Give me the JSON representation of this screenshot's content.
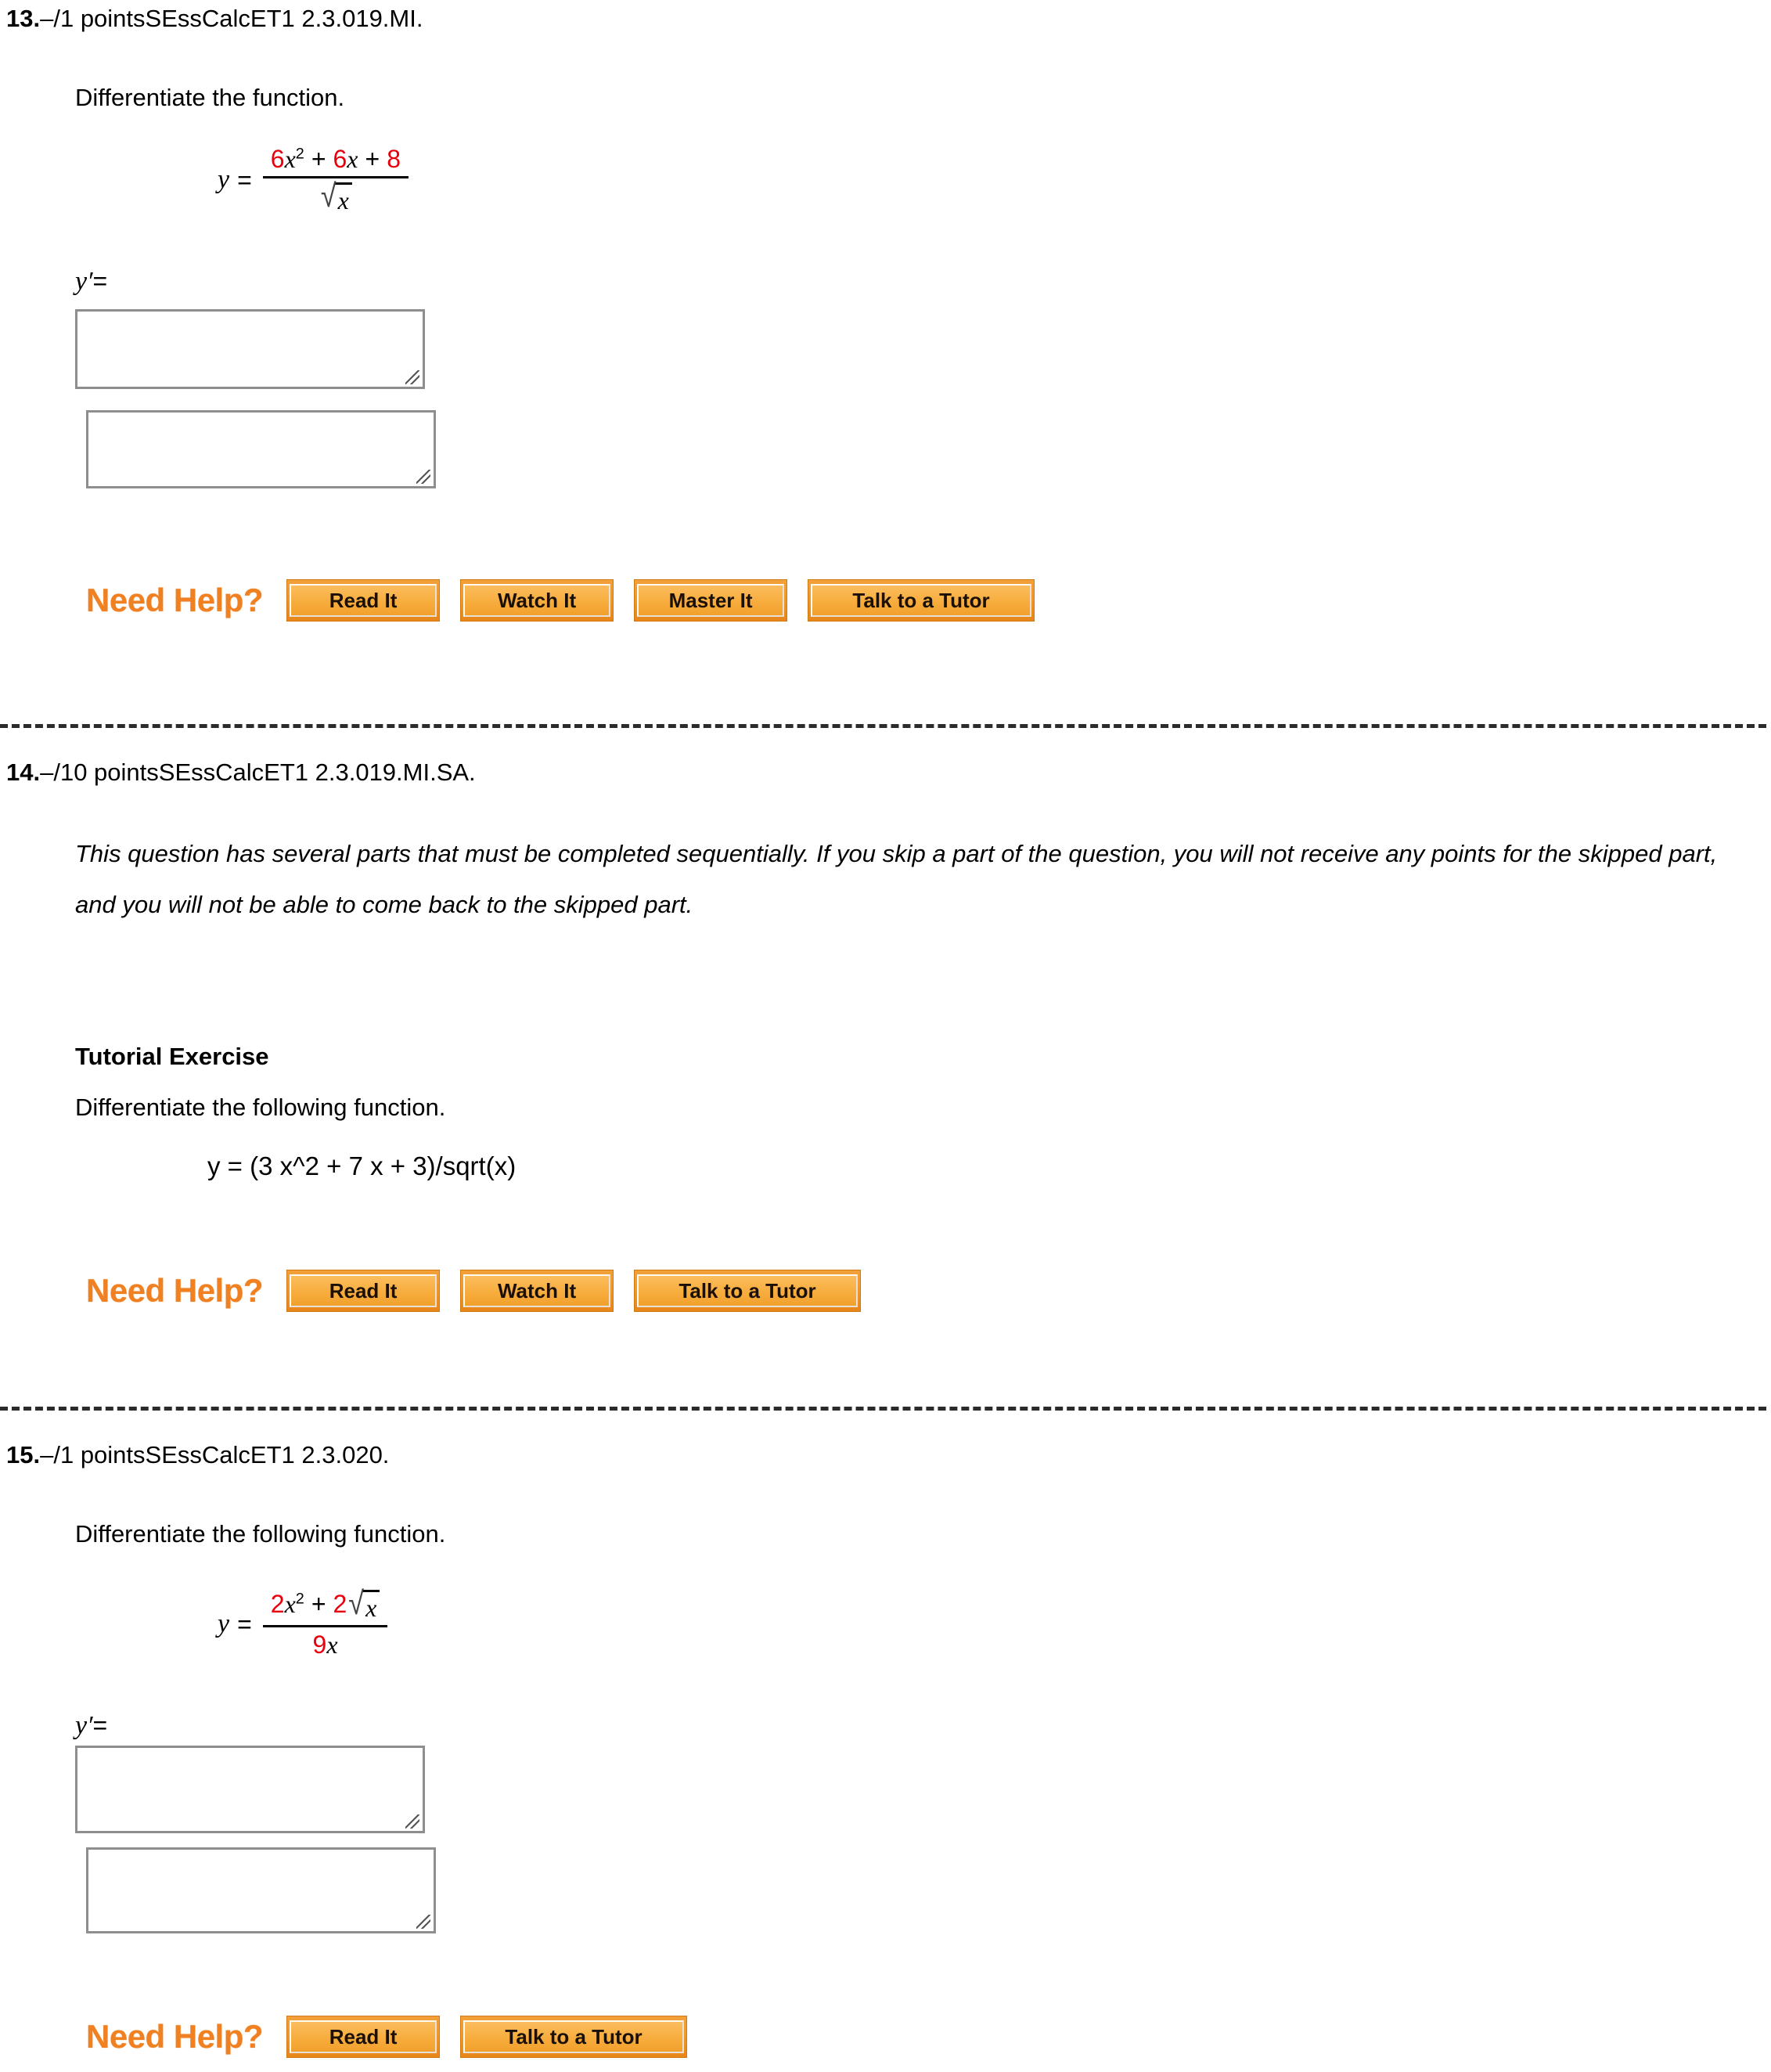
{
  "questions": [
    {
      "number": "13.",
      "points": "–/1 points",
      "code": "SEssCalcET1 2.3.019.MI.",
      "prompt": "Differentiate the function.",
      "formula": {
        "lhs": "y",
        "equals": "=",
        "numerator": {
          "t1_coef": "6",
          "t1_var": "x",
          "t1_exp": "2",
          "op1": "+",
          "t2_coef": "6",
          "t2_var": "x",
          "op2": "+",
          "t3_coef": "8"
        },
        "denominator": {
          "radical": "√",
          "radicand": "x"
        }
      },
      "answer_label": "y′",
      "answer_equals": "=",
      "answer_boxes": [
        {
          "value": "",
          "placeholder": ""
        },
        {
          "value": "",
          "placeholder": ""
        }
      ],
      "need_help": {
        "label": "Need Help?",
        "buttons": [
          "Read It",
          "Watch It",
          "Master It",
          "Talk to a Tutor"
        ]
      }
    },
    {
      "number": "14.",
      "points": "–/10 points",
      "code": "SEssCalcET1 2.3.019.MI.SA.",
      "note": "This question has several parts that must be completed sequentially. If you skip a part of the question, you will not receive any points for the skipped part, and you will not be able to come back to the skipped part.",
      "tutorial_title": "Tutorial Exercise",
      "prompt": "Differentiate the following function.",
      "plain_formula": "y = (3 x^2 + 7 x + 3)/sqrt(x)",
      "need_help": {
        "label": "Need Help?",
        "buttons": [
          "Read It",
          "Watch It",
          "Talk to a Tutor"
        ]
      }
    },
    {
      "number": "15.",
      "points": "–/1 points",
      "code": "SEssCalcET1 2.3.020.",
      "prompt": "Differentiate the following function.",
      "formula": {
        "lhs": "y",
        "equals": "=",
        "numerator": {
          "t1_coef": "2",
          "t1_var": "x",
          "t1_exp": "2",
          "op1": "+",
          "t2_coef": "2",
          "t2_radical": "√",
          "t2_radicand": "x"
        },
        "denominator": {
          "coef": "9",
          "var": "x"
        }
      },
      "answer_label": "y′",
      "answer_equals": "=",
      "answer_boxes": [
        {
          "value": "",
          "placeholder": ""
        },
        {
          "value": "",
          "placeholder": ""
        }
      ],
      "need_help": {
        "label": "Need Help?",
        "buttons": [
          "Read It",
          "Talk to a Tutor"
        ]
      }
    }
  ],
  "colors": {
    "math_highlight": "#e8000d",
    "need_help_orange": "#f08122",
    "button_fill": "#f7ad3e",
    "button_border": "#d07b10",
    "divider": "#2b2b2b",
    "input_border": "#8e8e8e"
  }
}
